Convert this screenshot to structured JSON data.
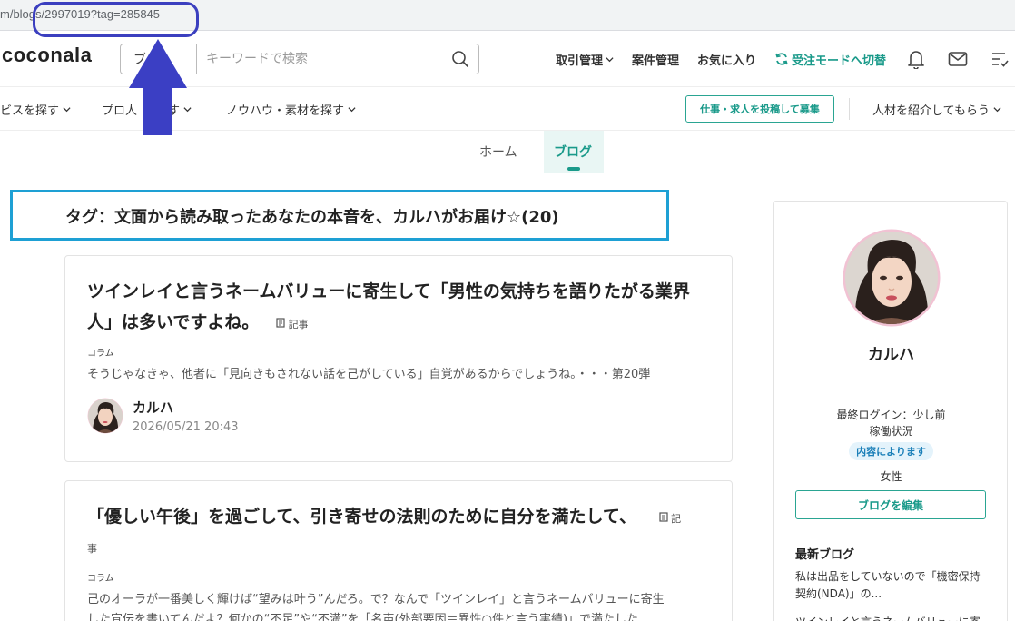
{
  "browser": {
    "url": "m/blogs/2997019?tag=285845"
  },
  "header": {
    "logo": "coconala",
    "search_category": "ブ",
    "search_placeholder": "キーワードで検索",
    "nav": {
      "transactions": "取引管理",
      "projects": "案件管理",
      "favorites": "お気に入り",
      "switch_mode": "受注モードへ切替"
    }
  },
  "subnav": {
    "find_services": "ビスを探す",
    "find_pros": "プロ人",
    "find_pros_tail": "す",
    "find_knowhow": "ノウハウ・素材を探す",
    "post_job": "仕事・求人を投稿して募集",
    "introduce": "人材を紹介してもらう"
  },
  "tabs": {
    "home": "ホーム",
    "blog": "ブログ"
  },
  "tag_heading": "タグ：文面から読み取ったあなたの本音を、カルハがお届け☆(20)",
  "articles": [
    {
      "title": "ツインレイと言うネームバリューに寄生して「男性の気持ちを語りたがる業界人」は多いですよね。",
      "badge": "記事",
      "category": "コラム",
      "excerpt": "そうじゃなきゃ、他者に「見向きもされない話を己がしている」自覚があるからでしょうね。・・・第20弾",
      "author": "カルハ",
      "date": "2026/05/21 20:43"
    },
    {
      "title": "「優しい午後」を過ごして、引き寄せの法則のために自分を満たして、",
      "badge_start": "記",
      "badge_end": "事",
      "category": "コラム",
      "excerpt_line1": "己のオーラが一番美しく輝けば“望みは叶う”んだろ。で？なんで「ツインレイ」と言うネームバリューに寄生",
      "excerpt_line2": "した宣伝を書いてんだよ？何かの“不足”や“不満”を「名声(外部要因＝異性○件と言う実績)」で満たした"
    }
  ],
  "sidebar": {
    "name": "カルハ",
    "last_login": "最終ログイン：少し前",
    "availability_label": "稼働状況",
    "availability_value": "内容によります",
    "gender": "女性",
    "edit_button": "ブログを編集",
    "latest_title": "最新ブログ",
    "latest": [
      "私は出品をしていないので「機密保持契約(NDA)」の...",
      "ツインレイと言うネームバリューに寄"
    ]
  },
  "colors": {
    "brand_green": "#1a9a8a",
    "annotation_blue": "#3b3fbf",
    "tag_box_blue": "#1ea0d4"
  }
}
